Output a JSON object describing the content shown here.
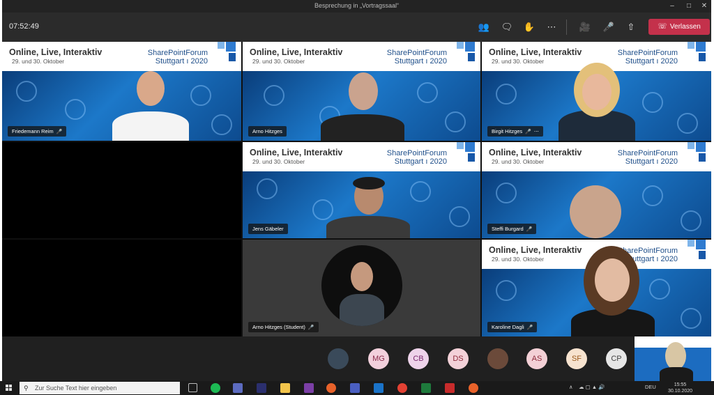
{
  "window": {
    "title": "Besprechung in „Vortragssaal“"
  },
  "toolbar": {
    "timer": "07:52:49",
    "leave_label": "Verlassen",
    "icons": [
      "participants-icon",
      "chat-icon",
      "raise-hand-icon",
      "more-options-icon",
      "camera-icon",
      "microphone-muted-icon",
      "share-screen-icon"
    ]
  },
  "banner": {
    "title": "Online, Live, Interaktiv",
    "date": "29. und 30. Oktober",
    "brand_line1": "SharePointForum",
    "brand_line2": "Stuttgart ı 2020"
  },
  "participants": [
    {
      "name": "Friedemann Reim"
    },
    {
      "name": "Arno Hitzges"
    },
    {
      "name": "Birgit Hitzges"
    },
    {
      "name": "Jens Gäbeler"
    },
    {
      "name": "Steffi Burgard"
    },
    {
      "name": "Arno Hitzges (Student)"
    },
    {
      "name": "Karoline Dagli"
    }
  ],
  "roster": [
    {
      "initials": "",
      "bg": "#3a4a5a",
      "fg": "#ffffff"
    },
    {
      "initials": "MG",
      "bg": "#f2d0dc",
      "fg": "#8a2b4a"
    },
    {
      "initials": "CB",
      "bg": "#eed3ea",
      "fg": "#7a2a6e"
    },
    {
      "initials": "DS",
      "bg": "#f3d1d8",
      "fg": "#8e2a3a"
    },
    {
      "initials": "",
      "bg": "#6b4a3a",
      "fg": "#ffffff"
    },
    {
      "initials": "AS",
      "bg": "#f3d0d6",
      "fg": "#8d2a3b"
    },
    {
      "initials": "SF",
      "bg": "#f7e3cf",
      "fg": "#9a5a1e"
    },
    {
      "initials": "CP",
      "bg": "#e6e6e6",
      "fg": "#444444"
    }
  ],
  "taskbar": {
    "search_placeholder": "Zur Suche Text hier eingeben",
    "language": "DEU",
    "time": "15:55",
    "date": "30.10.2020"
  },
  "colors": {
    "leave": "#c4314b",
    "banner_bg": "#ffffff",
    "video_blue": "#1c78c9"
  }
}
